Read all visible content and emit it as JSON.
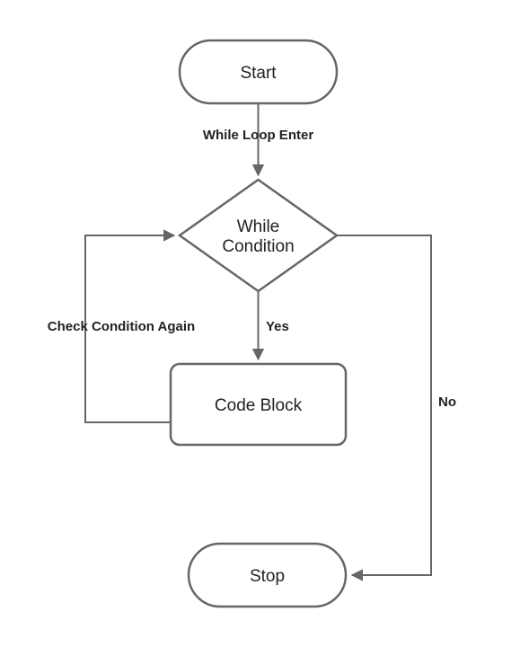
{
  "diagram": {
    "nodes": {
      "start": {
        "label": "Start"
      },
      "condition": {
        "line1": "While",
        "line2": "Condition"
      },
      "code_block": {
        "label": "Code Block"
      },
      "stop": {
        "label": "Stop"
      }
    },
    "edges": {
      "enter": {
        "label": "While Loop Enter"
      },
      "yes": {
        "label": "Yes"
      },
      "no": {
        "label": "No"
      },
      "loop_back": {
        "label": "Check Condition Again"
      }
    }
  }
}
